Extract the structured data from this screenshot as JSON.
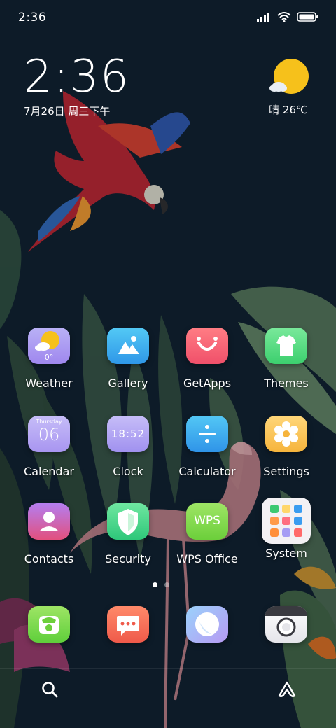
{
  "status_bar": {
    "time": "2:36"
  },
  "clock_widget": {
    "time": "2:36",
    "date": "7月26日 周三下午"
  },
  "weather_widget": {
    "text": "晴 26℃",
    "icon": "sun-with-cloud-icon"
  },
  "apps": [
    {
      "label": "Weather",
      "icon": "weather-icon",
      "badge": "0°"
    },
    {
      "label": "Gallery",
      "icon": "gallery-icon"
    },
    {
      "label": "GetApps",
      "icon": "getapps-icon"
    },
    {
      "label": "Themes",
      "icon": "themes-icon"
    },
    {
      "label": "Calendar",
      "icon": "calendar-icon",
      "weekday": "Thursday",
      "day": "06"
    },
    {
      "label": "Clock",
      "icon": "clock-icon",
      "time": "18:52"
    },
    {
      "label": "Calculator",
      "icon": "calculator-icon"
    },
    {
      "label": "Settings",
      "icon": "settings-icon"
    },
    {
      "label": "Contacts",
      "icon": "contacts-icon"
    },
    {
      "label": "Security",
      "icon": "security-icon"
    },
    {
      "label": "WPS Office",
      "icon": "wps-office-icon",
      "logo_text": "WPS"
    },
    {
      "label": "System",
      "icon": "system-folder-icon"
    }
  ],
  "dock": [
    {
      "icon": "phone-icon"
    },
    {
      "icon": "messages-icon"
    },
    {
      "icon": "browser-icon"
    },
    {
      "icon": "camera-icon"
    }
  ],
  "bottom_bar": {
    "left_icon": "search-icon",
    "right_icon": "assistant-icon"
  }
}
